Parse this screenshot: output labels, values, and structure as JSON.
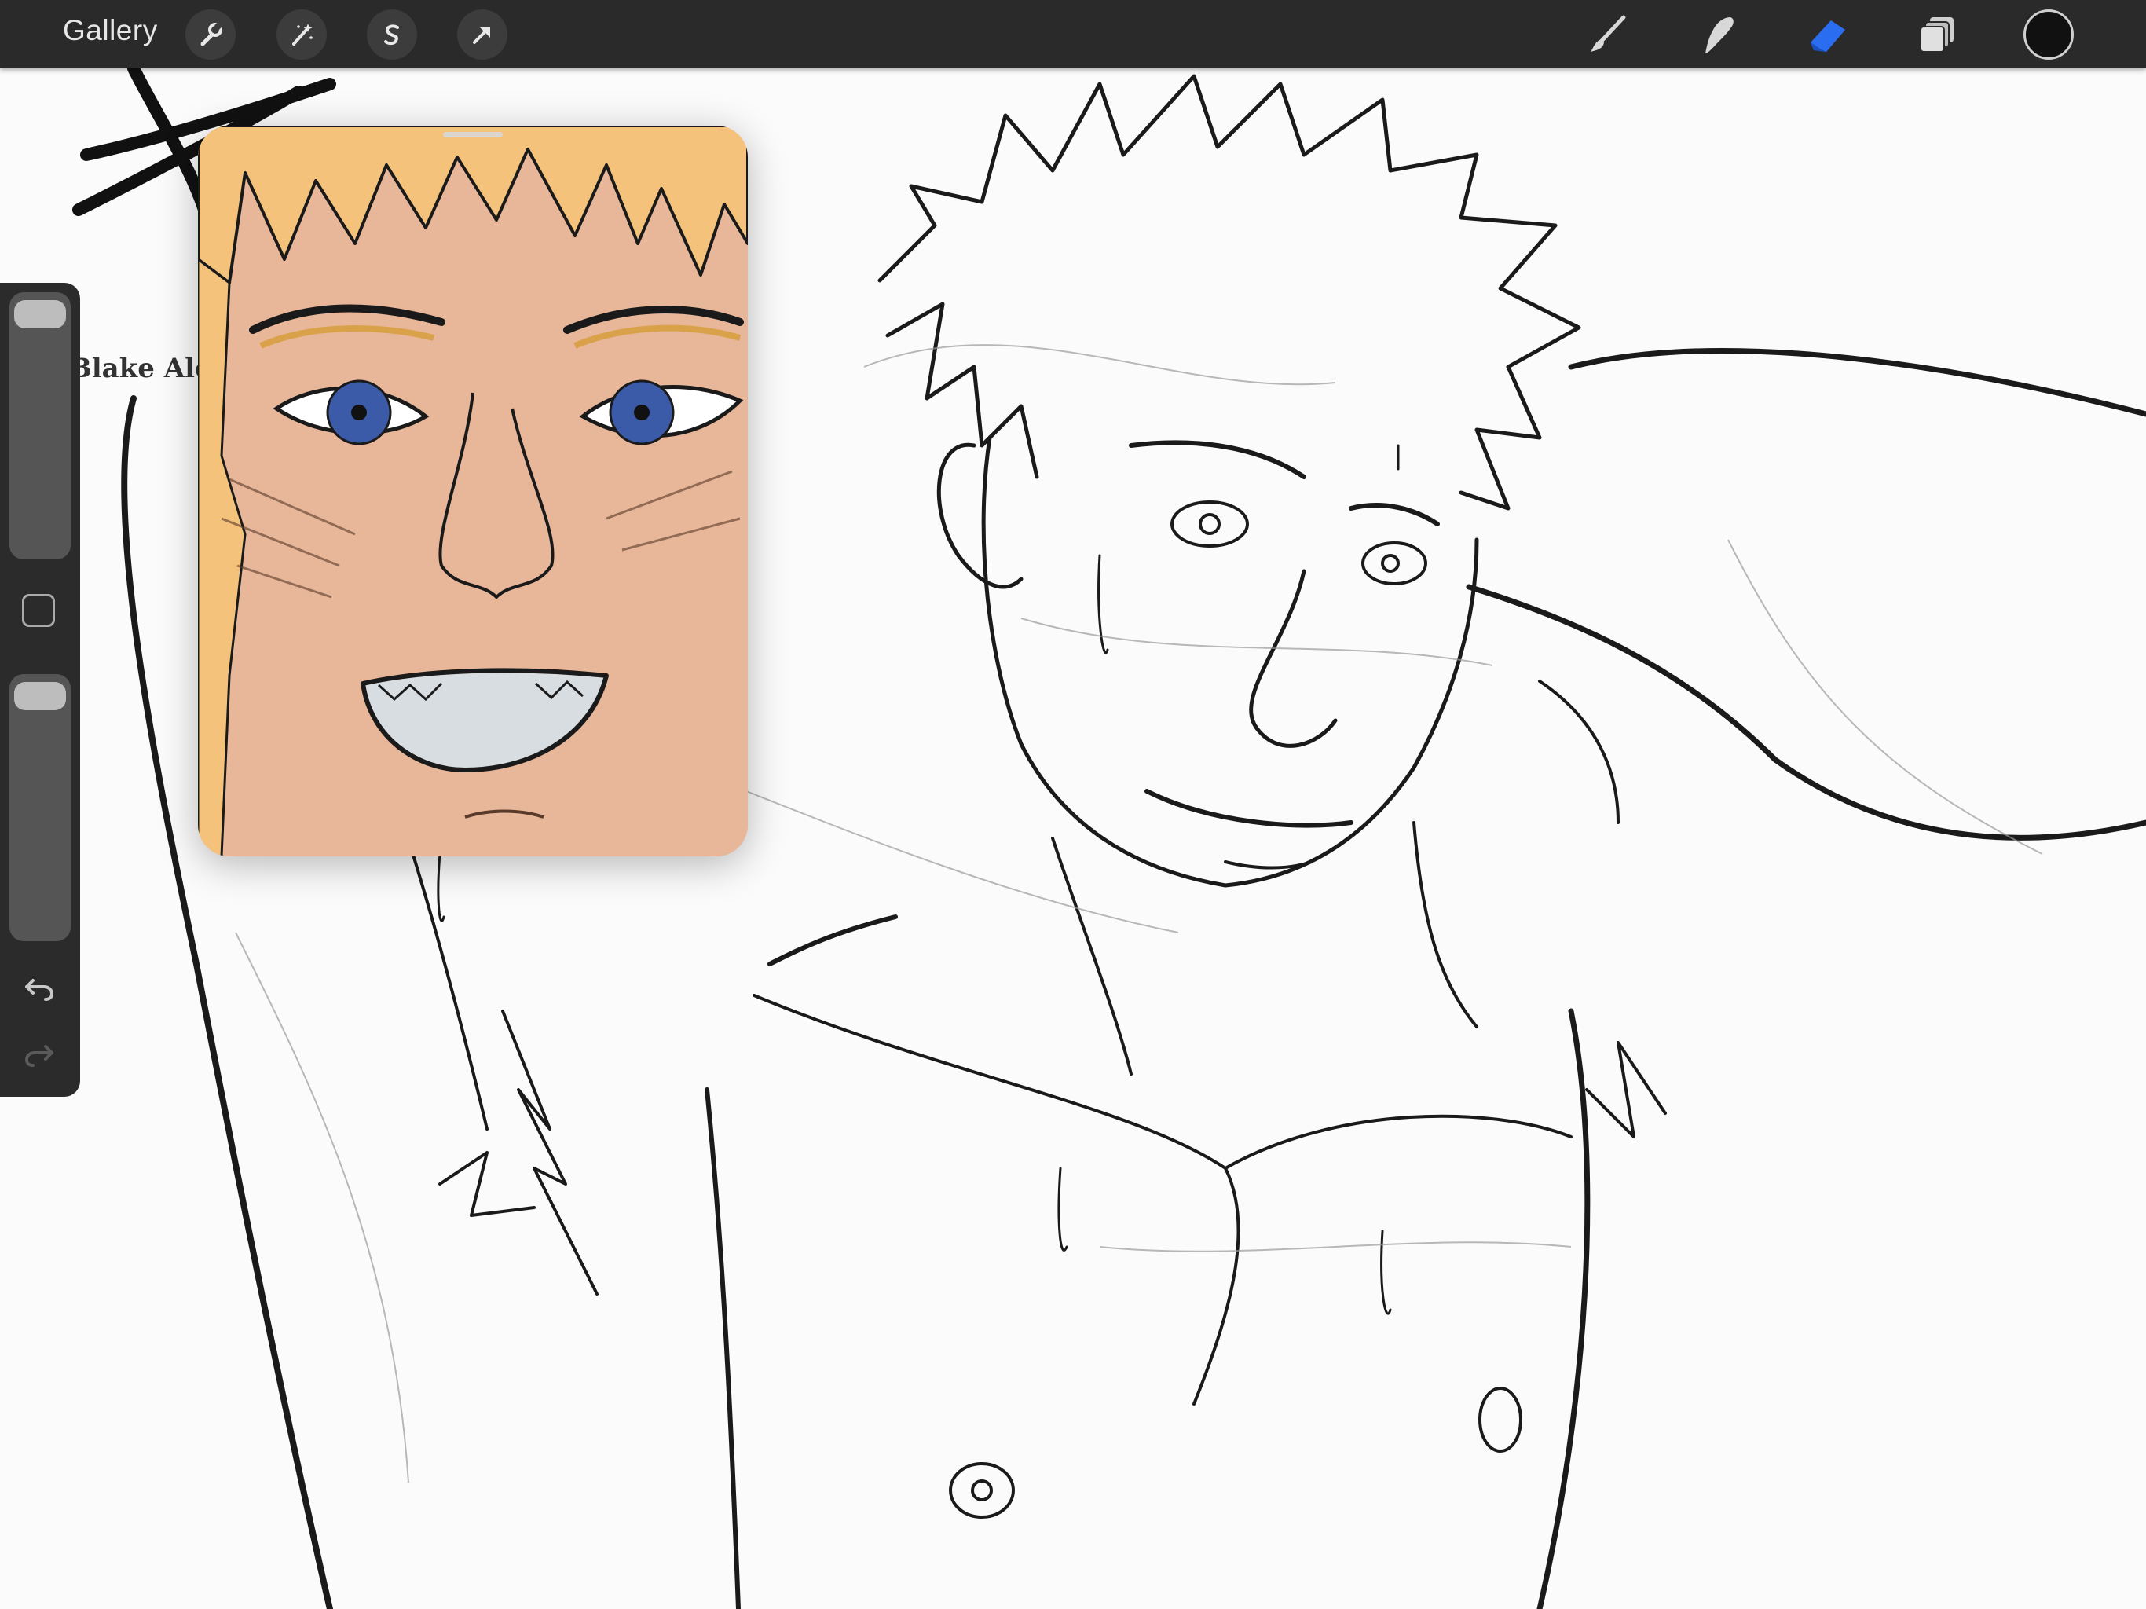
{
  "toolbar": {
    "gallery_label": "Gallery",
    "left_tools": [
      {
        "name": "actions",
        "icon": "wrench-icon"
      },
      {
        "name": "adjustments",
        "icon": "magic-wand-icon"
      },
      {
        "name": "selection",
        "icon": "selection-s-icon"
      },
      {
        "name": "transform",
        "icon": "arrow-cursor-icon"
      }
    ],
    "right_tools": [
      {
        "name": "brush",
        "icon": "brush-icon"
      },
      {
        "name": "smudge",
        "icon": "smudge-finger-icon"
      },
      {
        "name": "eraser",
        "icon": "eraser-icon",
        "active": true
      },
      {
        "name": "layers",
        "icon": "layers-icon"
      },
      {
        "name": "color",
        "icon": "color-swatch-icon",
        "value": "#111111"
      }
    ],
    "active_color": "#2b6df0"
  },
  "canvas": {
    "signature_text": "Blake Alex"
  },
  "sidebar": {
    "brush_size_level": 0.95,
    "opacity_level": 0.95,
    "modifier_icon": "square-modifier-icon",
    "undo_icon": "undo-icon",
    "redo_icon": "redo-icon"
  },
  "reference_window": {
    "content": "reference-image"
  }
}
